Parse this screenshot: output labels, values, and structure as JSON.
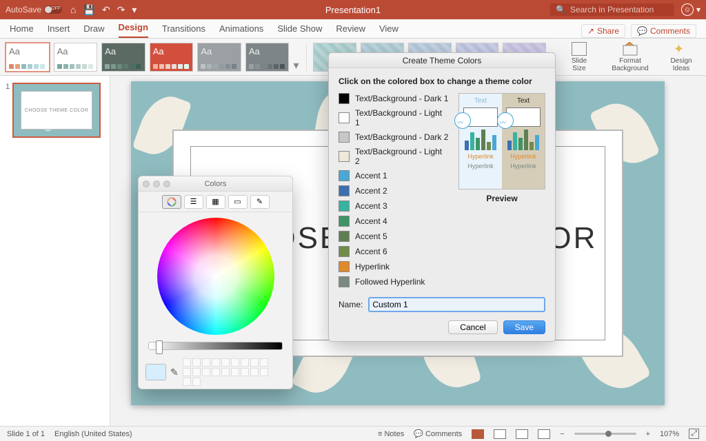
{
  "titlebar": {
    "autosave_label": "AutoSave",
    "autosave_state": "OFF",
    "doc_title": "Presentation1",
    "search_placeholder": "Search in Presentation"
  },
  "tabs": {
    "items": [
      "Home",
      "Insert",
      "Draw",
      "Design",
      "Transitions",
      "Animations",
      "Slide Show",
      "Review",
      "View"
    ],
    "active_index": 3,
    "share": "Share",
    "comments": "Comments"
  },
  "ribbon": {
    "slide_size": "Slide\nSize",
    "format_bg": "Format\nBackground",
    "design_ideas": "Design\nIdeas"
  },
  "slide": {
    "number": "1",
    "mini_text": "CHOOSE THEME COLOR",
    "big_text": "CHOOSE THEME COLOR"
  },
  "status": {
    "slide": "Slide 1 of 1",
    "lang": "English (United States)",
    "notes": "Notes",
    "comments": "Comments",
    "zoom": "107%"
  },
  "theme_dialog": {
    "title": "Create Theme Colors",
    "instruction": "Click on the colored box to change a theme color",
    "rows": [
      {
        "label": "Text/Background - Dark 1",
        "color": "#000000"
      },
      {
        "label": "Text/Background - Light 1",
        "color": "#ffffff"
      },
      {
        "label": "Text/Background - Dark 2",
        "color": "#c7c7c7"
      },
      {
        "label": "Text/Background - Light 2",
        "color": "#efe7d9"
      },
      {
        "label": "Accent 1",
        "color": "#4aa7d6"
      },
      {
        "label": "Accent 2",
        "color": "#3b6fb0"
      },
      {
        "label": "Accent 3",
        "color": "#37b3a2"
      },
      {
        "label": "Accent 4",
        "color": "#3e9466"
      },
      {
        "label": "Accent 5",
        "color": "#5e7f54"
      },
      {
        "label": "Accent 6",
        "color": "#6f8c4a"
      },
      {
        "label": "Hyperlink",
        "color": "#e08a2b"
      },
      {
        "label": "Followed Hyperlink",
        "color": "#7a8a80"
      }
    ],
    "preview_label": "Preview",
    "preview_text": "Text",
    "preview_link": "Hyperlink",
    "preview_followed": "Hyperlink",
    "name_label": "Name:",
    "name_value": "Custom 1",
    "cancel": "Cancel",
    "save": "Save"
  },
  "colors_panel": {
    "title": "Colors"
  }
}
